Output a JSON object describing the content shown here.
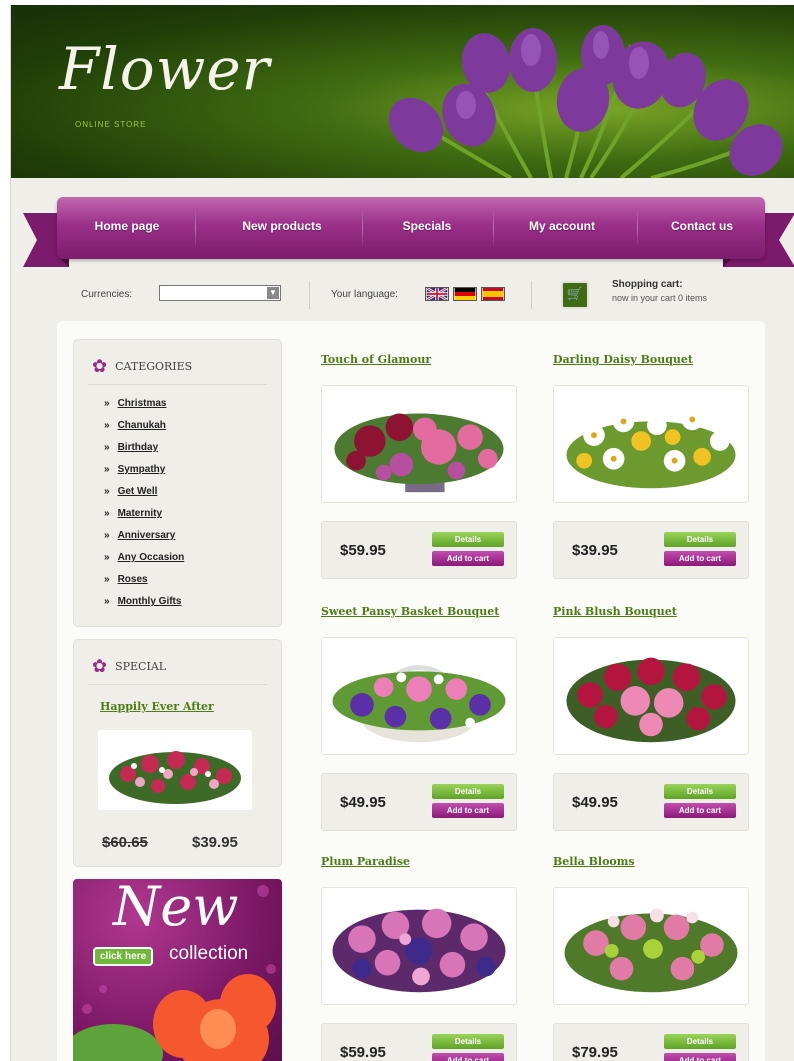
{
  "header": {
    "logo": "Flower",
    "subtitle": "ONLINE STORE"
  },
  "nav": {
    "items": [
      {
        "label": "Home page"
      },
      {
        "label": "New products"
      },
      {
        "label": "Specials"
      },
      {
        "label": "My account"
      },
      {
        "label": "Contact us"
      }
    ]
  },
  "tools": {
    "currencies_label": "Currencies:",
    "currency_value": "",
    "language_label": "Your language:",
    "flags": [
      "uk-flag",
      "german-flag",
      "spanish-flag"
    ],
    "cart_title": "Shopping cart:",
    "cart_status": "now in your cart 0 items"
  },
  "categories": {
    "title": "CATEGORIES",
    "items": [
      "Christmas",
      "Chanukah",
      "Birthday",
      "Sympathy",
      "Get Well",
      "Maternity",
      "Anniversary",
      "Any Occasion",
      "Roses",
      "Monthly Gifts"
    ]
  },
  "special": {
    "title": "SPECIAL",
    "product": "Happily Ever After",
    "old_price": "$60.65",
    "new_price": "$39.95"
  },
  "promo": {
    "headline": "New",
    "button": "click here",
    "tagline": "collection"
  },
  "products": [
    {
      "name": "Touch of Glamour",
      "price": "$59.95",
      "details": "Details",
      "add": "Add to cart"
    },
    {
      "name": "Darling Daisy Bouquet",
      "price": "$39.95",
      "details": "Details",
      "add": "Add to cart"
    },
    {
      "name": "Sweet Pansy Basket Bouquet",
      "price": "$49.95",
      "details": "Details",
      "add": "Add to cart"
    },
    {
      "name": "Pink Blush Bouquet",
      "price": "$49.95",
      "details": "Details",
      "add": "Add to cart"
    },
    {
      "name": "Plum Paradise",
      "price": "$59.95",
      "details": "Details",
      "add": "Add to cart"
    },
    {
      "name": "Bella Blooms",
      "price": "$79.95",
      "details": "Details",
      "add": "Add to cart"
    }
  ],
  "colors": {
    "brand_purple": "#8a1877",
    "brand_green": "#4d7d14",
    "background": "#efeee9"
  }
}
